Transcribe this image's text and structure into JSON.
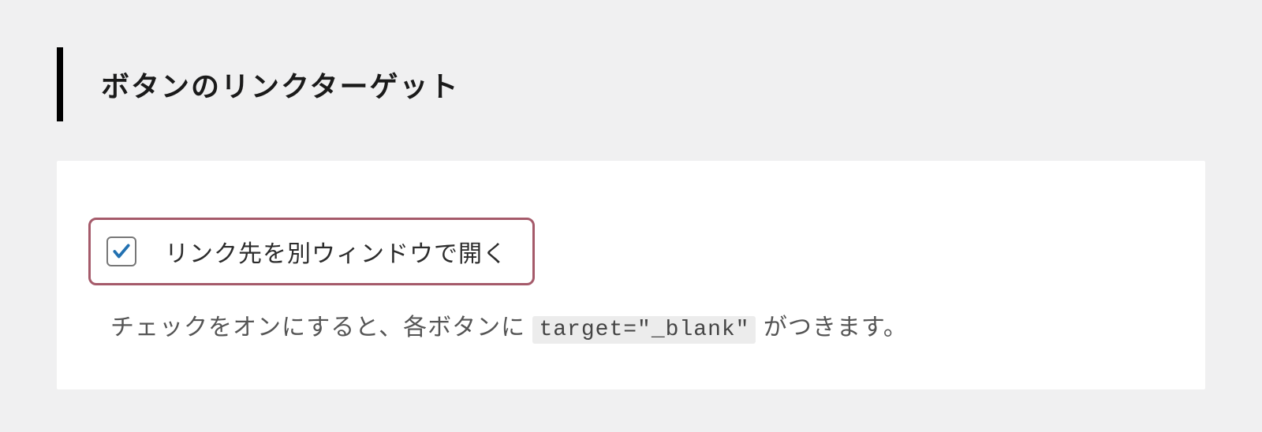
{
  "section": {
    "title": "ボタンのリンクターゲット"
  },
  "setting": {
    "checkbox_label": "リンク先を別ウィンドウで開く",
    "checked": true,
    "description_before": "チェックをオンにすると、各ボタンに ",
    "description_code": "target=\"_blank\"",
    "description_after": " がつきます。"
  }
}
